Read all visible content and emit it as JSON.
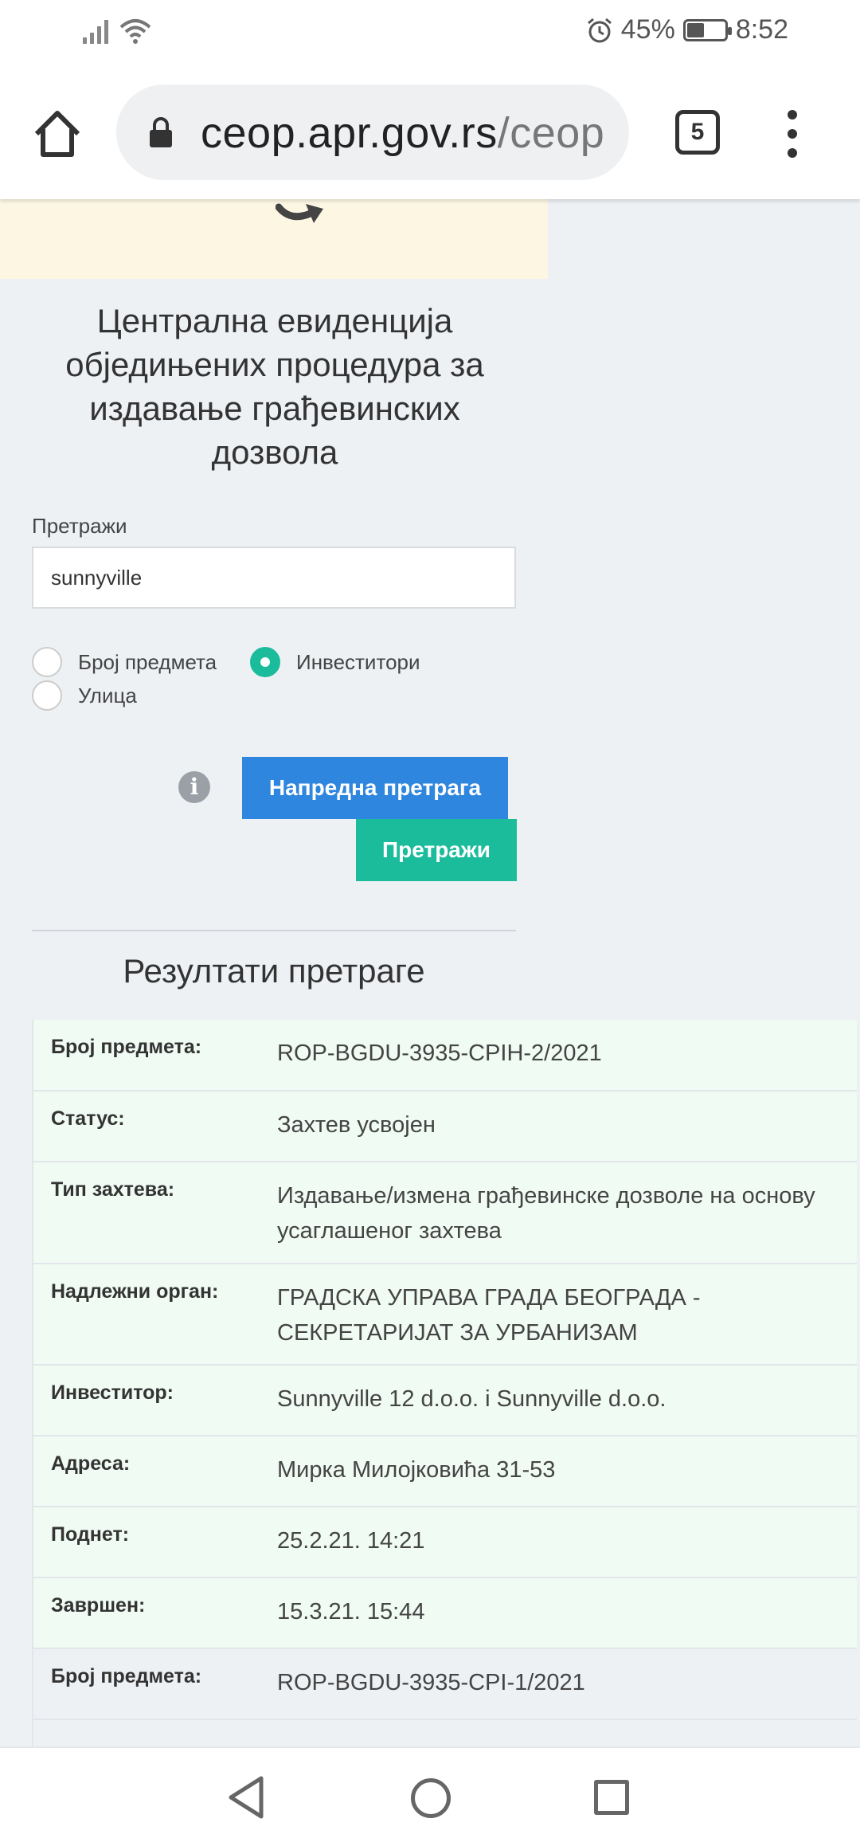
{
  "status_bar": {
    "battery_percent": "45%",
    "battery_level": 0.45,
    "time": "8:52",
    "icons": [
      "signal-icon",
      "wifi-icon",
      "alarm-icon",
      "battery-icon"
    ]
  },
  "browser": {
    "url_domain": "ceop.apr.gov.rs",
    "url_path": "/ceop",
    "tab_count": "5"
  },
  "page": {
    "title": "Централна евиденција обједињених процедура за издавање грађевинских дозвола",
    "search_label": "Претражи",
    "search_value": "sunnyville",
    "radios": [
      {
        "label": "Број предмета",
        "checked": false
      },
      {
        "label": "Инвеститори",
        "checked": true
      },
      {
        "label": "Улица",
        "checked": false
      }
    ],
    "advanced_button": "Напредна претрага",
    "search_button": "Претражи",
    "results_title": "Резултати претраге",
    "accent_green": "#1abc9c",
    "accent_blue": "#2e86de"
  },
  "results": [
    {
      "label": "Број предмета:",
      "value": "ROP-BGDU-3935-CPIH-2/2021"
    },
    {
      "label": "Статус:",
      "value": "Захтев усвојен"
    },
    {
      "label": "Тип захтева:",
      "value": "Издавање/измена грађевинске дозволе на основу усаглашеног захтева"
    },
    {
      "label": "Надлежни орган:",
      "value": "ГРАДСКА УПРАВА ГРАДА БЕОГРАДА - СЕКРЕТАРИЈАТ ЗА УРБАНИЗАМ"
    },
    {
      "label": "Инвеститор:",
      "value": "Sunnyville 12 d.o.o. i Sunnyville d.o.o."
    },
    {
      "label": "Адреса:",
      "value": "Мирка Милојковића 31-53"
    },
    {
      "label": "Поднет:",
      "value": "25.2.21. 14:21"
    },
    {
      "label": "Завршен:",
      "value": "15.3.21. 15:44"
    },
    {
      "label": "Број предмета:",
      "value": "ROP-BGDU-3935-CPI-1/2021"
    }
  ]
}
